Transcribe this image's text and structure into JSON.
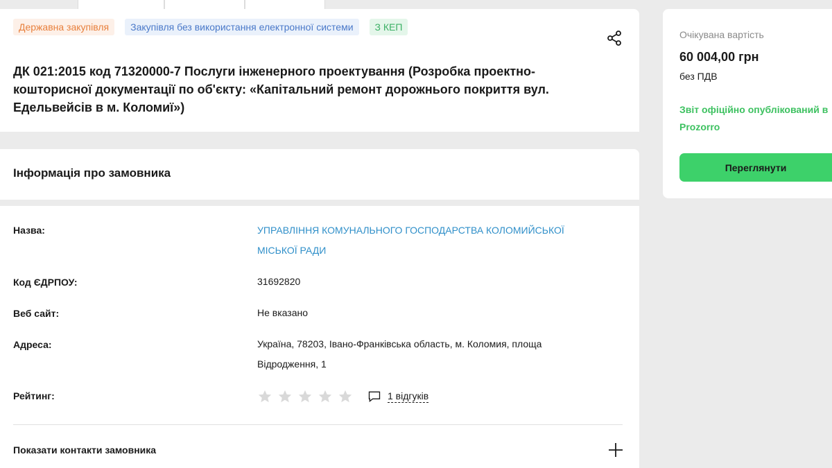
{
  "tender": {
    "tags": {
      "type": "Державна закупівля",
      "method": "Закупівля без використання електронної системи",
      "kep": "З КЕП"
    },
    "title": "ДК 021:2015 код 71320000-7 Послуги інженерного проектування (Розробка проектно-кошторисної документації по об'єкту: «Капітальний ремонт дорожнього покриття вул. Едельвейсів в м. Коломиї»)"
  },
  "customer": {
    "section_title": "Інформація про замовника",
    "name_label": "Назва:",
    "name_value": "УПРАВЛІННЯ КОМУНАЛЬНОГО ГОСПОДАРСТВА КОЛОМИЙСЬКОЇ МІСЬКОЇ РАДИ",
    "edrpou_label": "Код ЄДРПОУ:",
    "edrpou_value": "31692820",
    "website_label": "Веб сайт:",
    "website_value": "Не вказано",
    "address_label": "Адреса:",
    "address_value": "Україна, 78203, Івано-Франківська область, м. Коломия, площа Відродження, 1",
    "rating_label": "Рейтинг:",
    "rating_stars": 0,
    "rating_max": 5,
    "reviews_link": "1 відгуків",
    "show_contacts": "Показати контакти замовника"
  },
  "sidebar": {
    "expected_value_label": "Очікувана вартість",
    "amount": "60 004,00 грн",
    "vat_note": "без ПДВ",
    "report_status": "Звіт офіційно опублікований в Prozorro",
    "view_button": "Переглянути"
  },
  "colors": {
    "accent_green": "#3dd16a",
    "link_blue": "#2f8fc9",
    "tag_orange": "#e8803d",
    "tag_blue": "#4a79c9",
    "tag_green": "#3cb065"
  },
  "icons": {
    "share": "share-icon",
    "star": "star-icon",
    "comment": "comment-icon",
    "plus": "plus-icon"
  }
}
